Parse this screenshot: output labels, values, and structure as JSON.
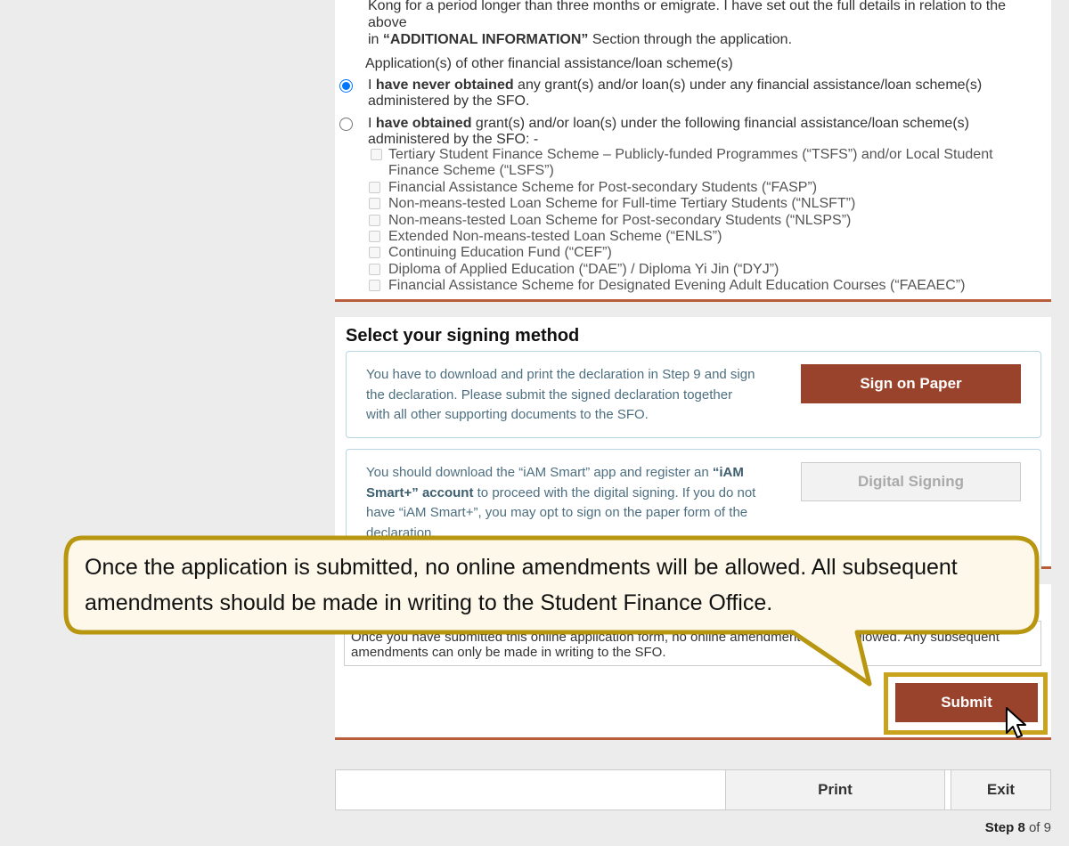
{
  "applications": {
    "intro_line1": "Kong for a period longer than three months or emigrate. I have set out the full details in relation to the above",
    "intro_line2_pre": "in ",
    "intro_line2_bold": "“ADDITIONAL INFORMATION”",
    "intro_line2_post": " Section through the application.",
    "question": "Application(s) of other financial assistance/loan scheme(s)",
    "option_never": {
      "prefix": "I ",
      "bold": "have never obtained",
      "rest": " any grant(s) and/or loan(s) under any financial assistance/loan scheme(s) administered by the SFO.",
      "selected": true
    },
    "option_obtained": {
      "prefix": "I ",
      "bold": "have obtained",
      "rest": " grant(s) and/or loan(s) under the following financial assistance/loan scheme(s) administered by the SFO: -",
      "selected": false
    },
    "schemes": [
      "Tertiary Student Finance Scheme – Publicly-funded Programmes (“TSFS”) and/or Local Student Finance Scheme (“LSFS”)",
      "Financial Assistance Scheme for Post-secondary Students (“FASP”)",
      "Non-means-tested Loan Scheme for Full-time Tertiary Students (“NLSFT”)",
      "Non-means-tested Loan Scheme for Post-secondary Students (“NLSPS”)",
      "Extended Non-means-tested Loan Scheme (“ENLS”)",
      "Continuing Education Fund (“CEF”)",
      "Diploma of Applied Education (“DAE”) / Diploma Yi Jin (“DYJ”)",
      "Financial Assistance Scheme for Designated Evening Adult Education Courses (“FAEAEC”)"
    ]
  },
  "signing": {
    "title": "Select your signing method",
    "paper_desc": "You have to download and print the declaration in Step 9 and sign the declaration. Please submit the signed declaration together with all other supporting documents to the SFO.",
    "paper_button": "Sign on Paper",
    "digital_desc_pre": "You should download the “iAM Smart” app and register an ",
    "digital_desc_bold": "“iAM Smart+” account",
    "digital_desc_post": " to proceed with the digital signing. If you do not have “iAM Smart+”, you may opt to sign on the paper form of the declaration.",
    "digital_button": "Digital Signing"
  },
  "submit_section": {
    "notice": "Once you have submitted this online application form, no online amendments will be allowed. Any subsequent amendments can only be made in writing to the SFO.",
    "submit_button": "Submit"
  },
  "footer": {
    "print_button": "Print",
    "exit_button": "Exit",
    "step_label": "Step",
    "step_current": "8",
    "step_of": "of 9"
  },
  "callout": {
    "text": "Once the application is submitted, no online amendments will be allowed. All subsequent amendments should be made in writing to the Student Finance Office.",
    "border_color": "#b8960f",
    "fill_color": "#fdf8ea"
  },
  "colors": {
    "accent": "#9a432c",
    "divider": "#b85c3a",
    "radio_selected": "#0075ff",
    "highlight_frame": "#c9a21e"
  }
}
